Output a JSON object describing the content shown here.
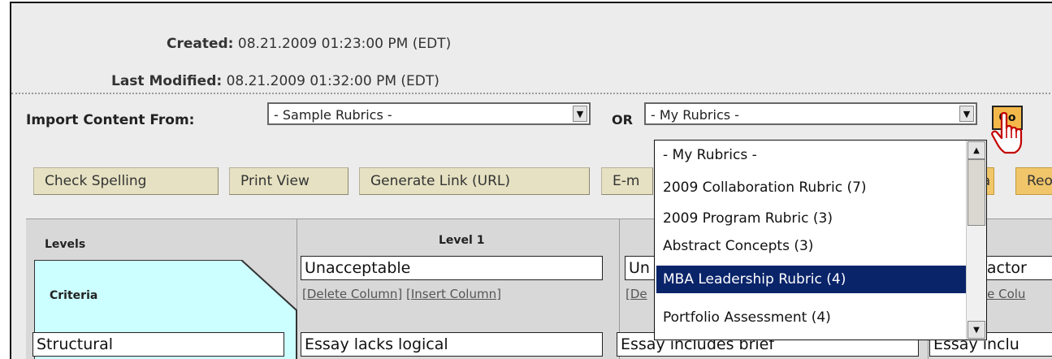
{
  "meta": {
    "created_label": "Created:",
    "created_value": "08.21.2009 01:23:00 PM (EDT)",
    "modified_label": "Last Modified:",
    "modified_value": "08.21.2009 01:32:00 PM (EDT)"
  },
  "import": {
    "label": "Import Content From:",
    "sample_select_value": "- Sample Rubrics -",
    "or_label": "OR",
    "my_select_value": "- My Rubrics -",
    "go_label": "Go"
  },
  "dropdown": {
    "options": [
      "- My Rubrics -",
      "2009 Collaboration Rubric (7)",
      "2009 Program Rubric (3)",
      "Abstract Concepts (3)",
      "MBA Leadership Rubric (4)",
      "Portfolio Assessment (4)"
    ],
    "selected_option": "MBA Leadership Rubric (4)"
  },
  "toolbar": {
    "check_spelling": "Check Spelling",
    "print_view": "Print View",
    "generate_link": "Generate Link (URL)",
    "email_partial": "E-m",
    "save_partial": "Sa",
    "reorder_partial": "Reo"
  },
  "grid": {
    "levels_label": "Levels",
    "criteria_label": "Criteria",
    "level1_label": "Level 1",
    "level1_name": "Unacceptable",
    "level2_name_partial": "Un",
    "level3_name_partial": "isfactor",
    "delete_column": "Delete Column",
    "insert_column": "Insert Column",
    "level2_links_partial": "De",
    "level3_links_partial": "ete Colu",
    "criterion1": "Structural",
    "cell1": "Essay lacks logical",
    "cell2": "Essay includes brief",
    "cell3_partial": "Essay inclu"
  },
  "colors": {
    "panel_bg": "#ececec",
    "button_bg": "#e5e1c2",
    "go_button_bg": "#f4b84a",
    "selection_bg": "#0a246a",
    "criteria_cell_bg": "#ccffff"
  }
}
